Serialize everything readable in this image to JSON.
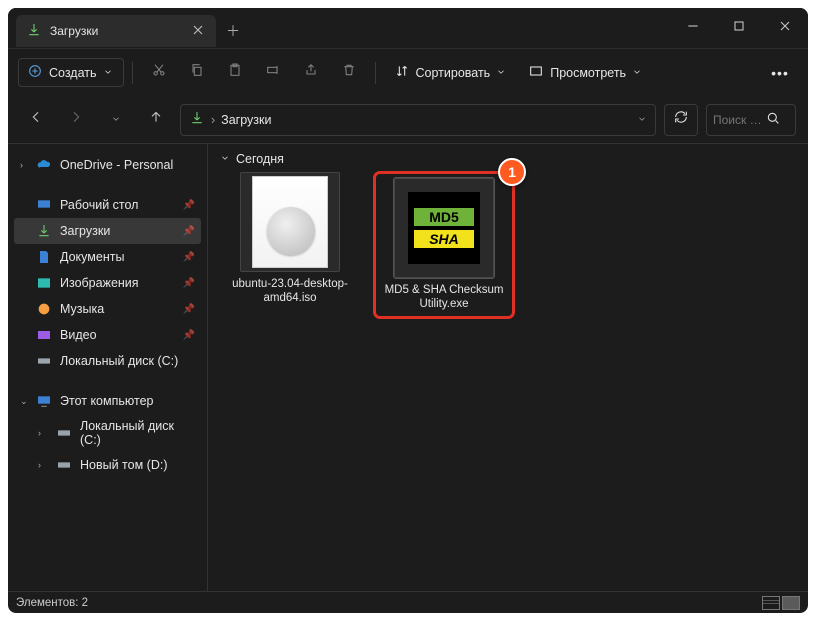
{
  "titlebar": {
    "tab_label": "Загрузки"
  },
  "toolbar": {
    "create_label": "Создать",
    "sort_label": "Сортировать",
    "view_label": "Просмотреть"
  },
  "address": {
    "crumb": "Загрузки"
  },
  "search": {
    "placeholder": "Поиск …"
  },
  "sidebar": {
    "onedrive": "OneDrive - Personal",
    "desktop": "Рабочий стол",
    "downloads": "Загрузки",
    "documents": "Документы",
    "pictures": "Изображения",
    "music": "Музыка",
    "videos": "Видео",
    "local_c": "Локальный диск (C:)",
    "this_pc": "Этот компьютер",
    "local_c2": "Локальный диск (C:)",
    "new_vol_d": "Новый том (D:)"
  },
  "content": {
    "group_label": "Сегодня",
    "items": [
      {
        "name": "ubuntu-23.04-desktop-amd64.iso"
      },
      {
        "name": "MD5 & SHA Checksum Utility.exe"
      }
    ],
    "annotation_badge": "1",
    "md5_label": "MD5",
    "sha_label": "SHA"
  },
  "status": {
    "count_label": "Элементов: 2"
  }
}
